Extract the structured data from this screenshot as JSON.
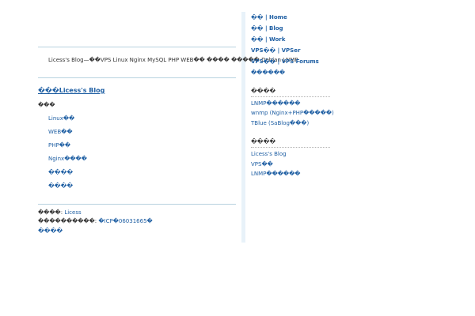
{
  "main": {
    "site_description": "Licess's Blog—��VPS Linux Nginx MySQL PHP WEB�� ���� ����� Debian LNMP",
    "blog_title": "���Licess's Blog",
    "categories_heading": "���",
    "categories": [
      {
        "label": "Linux��"
      },
      {
        "label": "WEB��"
      },
      {
        "label": "PHP��"
      },
      {
        "label": "Nginx����"
      },
      {
        "label": "����"
      },
      {
        "label": "����"
      }
    ],
    "footer": {
      "author_label": "����:",
      "author_value": "Licess",
      "icp_label": "����������:",
      "icp_value": "�ICP�06031665�",
      "link": "����"
    }
  },
  "sidebar": {
    "nav": [
      {
        "label": "�� | Home"
      },
      {
        "label": "�� | Blog"
      },
      {
        "label": "�� | Work"
      },
      {
        "label": "VPS�� | VPSer"
      },
      {
        "label": "VPS�� | VPS Forums"
      },
      {
        "label": "������"
      }
    ],
    "section1": {
      "heading": "����",
      "links": [
        {
          "label": "LNMP������"
        },
        {
          "label": "wnmp (Nginx+PHP�����)"
        },
        {
          "label": "TBlue (SaBlog���)"
        }
      ]
    },
    "section2": {
      "heading": "����",
      "links": [
        {
          "label": "Licess's Blog"
        },
        {
          "label": "VPS��"
        },
        {
          "label": "LNMP������"
        }
      ]
    }
  }
}
